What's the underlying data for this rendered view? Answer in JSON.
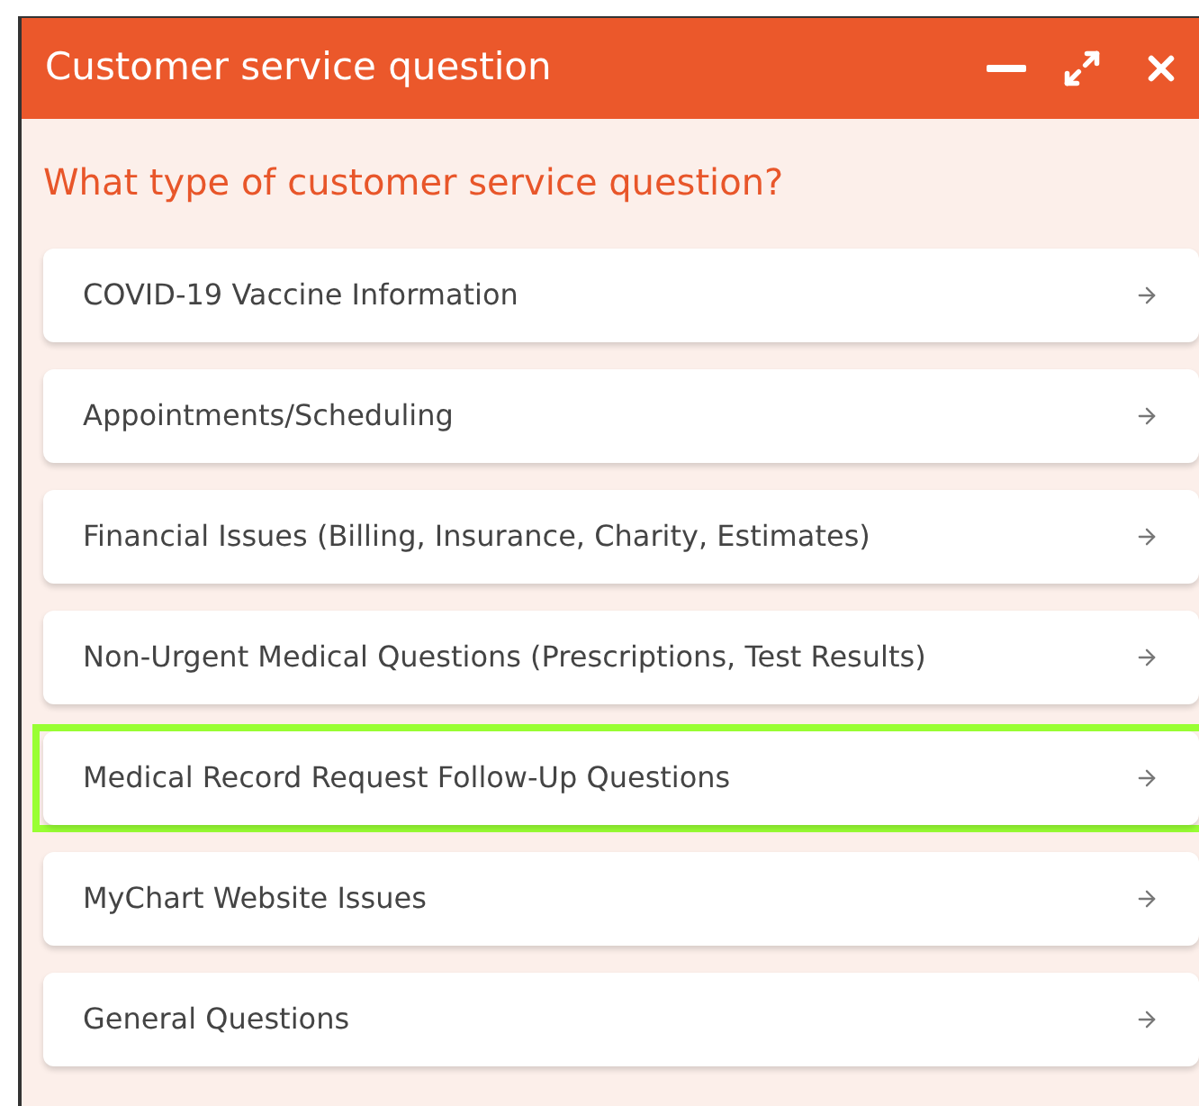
{
  "window": {
    "title": "Customer service question"
  },
  "question": "What type of customer service question?",
  "options": [
    {
      "label": "COVID-19 Vaccine Information",
      "selected": false
    },
    {
      "label": "Appointments/Scheduling",
      "selected": false
    },
    {
      "label": "Financial Issues (Billing, Insurance, Charity, Estimates)",
      "selected": false
    },
    {
      "label": "Non-Urgent Medical Questions (Prescriptions, Test Results)",
      "selected": false
    },
    {
      "label": "Medical Record Request Follow-Up Questions",
      "selected": true
    },
    {
      "label": "MyChart Website Issues",
      "selected": false
    },
    {
      "label": "General Questions",
      "selected": false
    }
  ]
}
